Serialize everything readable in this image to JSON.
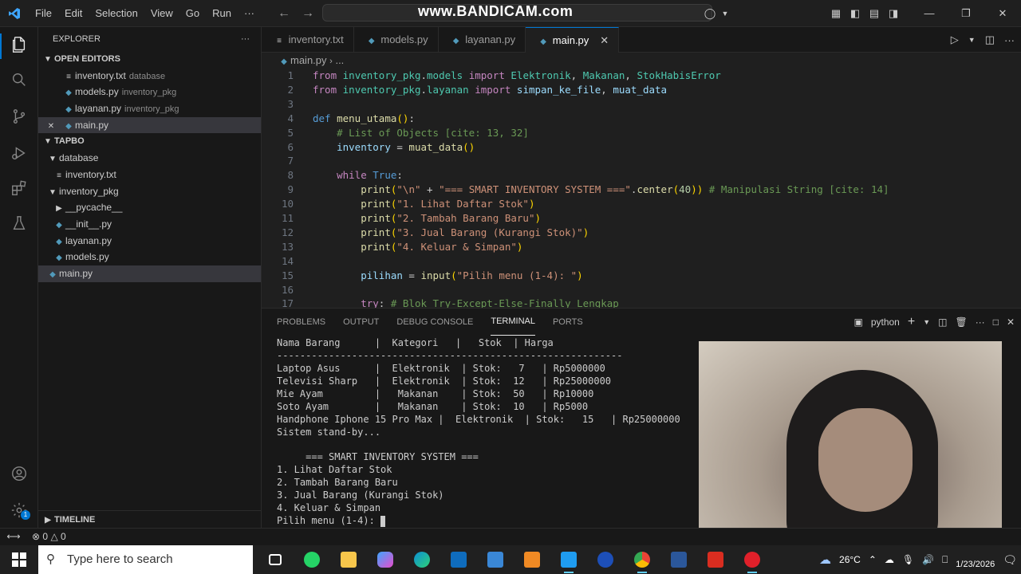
{
  "titlebar": {
    "menu": [
      "File",
      "Edit",
      "Selection",
      "View",
      "Go",
      "Run",
      "···"
    ],
    "watermark": "www.BANDICAM.com"
  },
  "sidebar": {
    "title": "EXPLORER",
    "open_editors_label": "OPEN EDITORS",
    "open_editors": [
      {
        "name": "inventory.txt",
        "desc": "database",
        "kind": "txt"
      },
      {
        "name": "models.py",
        "desc": "inventory_pkg",
        "kind": "py"
      },
      {
        "name": "layanan.py",
        "desc": "inventory_pkg",
        "kind": "py"
      },
      {
        "name": "main.py",
        "desc": "",
        "kind": "py"
      }
    ],
    "project_label": "TAPBO",
    "tree": [
      {
        "name": "database",
        "kind": "folder-open"
      },
      {
        "name": "inventory.txt",
        "kind": "txt"
      },
      {
        "name": "inventory_pkg",
        "kind": "folder-open"
      },
      {
        "name": "__pycache__",
        "kind": "folder"
      },
      {
        "name": "__init__.py",
        "kind": "py"
      },
      {
        "name": "layanan.py",
        "kind": "py"
      },
      {
        "name": "models.py",
        "kind": "py"
      },
      {
        "name": "main.py",
        "kind": "py"
      }
    ],
    "timeline_label": "TIMELINE"
  },
  "tabs": [
    {
      "label": "inventory.txt",
      "kind": "txt"
    },
    {
      "label": "models.py",
      "kind": "py"
    },
    {
      "label": "layanan.py",
      "kind": "py"
    },
    {
      "label": "main.py",
      "kind": "py",
      "active": true
    }
  ],
  "breadcrumb": {
    "file": "main.py",
    "rest": "..."
  },
  "editor": {
    "line_numbers": [
      "1",
      "2",
      "3",
      "4",
      "5",
      "6",
      "7",
      "8",
      "9",
      "10",
      "11",
      "12",
      "13",
      "14",
      "15",
      "16",
      "17"
    ],
    "lines": [
      "from inventory_pkg.models import Elektronik, Makanan, StokHabisError",
      "from inventory_pkg.layanan import simpan_ke_file, muat_data",
      "",
      "def menu_utama():",
      "    # List of Objects [cite: 13, 32]",
      "    inventory = muat_data()",
      "",
      "    while True:",
      "        print(\"\\n\" + \"=== SMART INVENTORY SYSTEM ===\".center(40)) # Manipulasi String [cite: 14]",
      "        print(\"1. Lihat Daftar Stok\")",
      "        print(\"2. Tambah Barang Baru\")",
      "        print(\"3. Jual Barang (Kurangi Stok)\")",
      "        print(\"4. Keluar & Simpan\")",
      "",
      "        pilihan = input(\"Pilih menu (1-4): \")",
      "",
      "        try: # Blok Try-Except-Else-Finally Lengkap"
    ]
  },
  "panel": {
    "tabs": [
      "PROBLEMS",
      "OUTPUT",
      "DEBUG CONSOLE",
      "TERMINAL",
      "PORTS"
    ],
    "active_tab": "TERMINAL",
    "shell": "python",
    "terminal_lines": [
      "Nama Barang      |  Kategori   |   Stok  | Harga",
      "------------------------------------------------------------",
      "Laptop Asus      |  Elektronik  | Stok:   7   | Rp5000000",
      "Televisi Sharp   |  Elektronik  | Stok:  12   | Rp25000000",
      "Mie Ayam         |   Makanan    | Stok:  50   | Rp10000",
      "Soto Ayam        |   Makanan    | Stok:  10   | Rp5000",
      "Handphone Iphone 15 Pro Max |  Elektronik  | Stok:   15   | Rp25000000",
      "Sistem stand-by...",
      "",
      "     === SMART INVENTORY SYSTEM ===",
      "1. Lihat Daftar Stok",
      "2. Tambah Barang Baru",
      "3. Jual Barang (Kurangi Stok)",
      "4. Keluar & Simpan",
      "Pilih menu (1-4): "
    ]
  },
  "statusbar": {
    "errors": "0",
    "warnings": "0"
  },
  "taskbar": {
    "search_placeholder": "Type here to search",
    "apps": [
      "task-view",
      "whatsapp",
      "file-explorer",
      "copilot",
      "edge",
      "outlook",
      "microsoft-store",
      "app-orange",
      "vscode",
      "app-blue",
      "chrome",
      "word",
      "acrobat",
      "bandicam"
    ],
    "temperature": "26°C",
    "date": "1/23/2026"
  },
  "activity_badge": "1",
  "colors": {
    "accent": "#0078d4",
    "python_icon": "#519aba",
    "keyword": "#c586c0",
    "string": "#ce9178",
    "comment": "#6a9955"
  }
}
